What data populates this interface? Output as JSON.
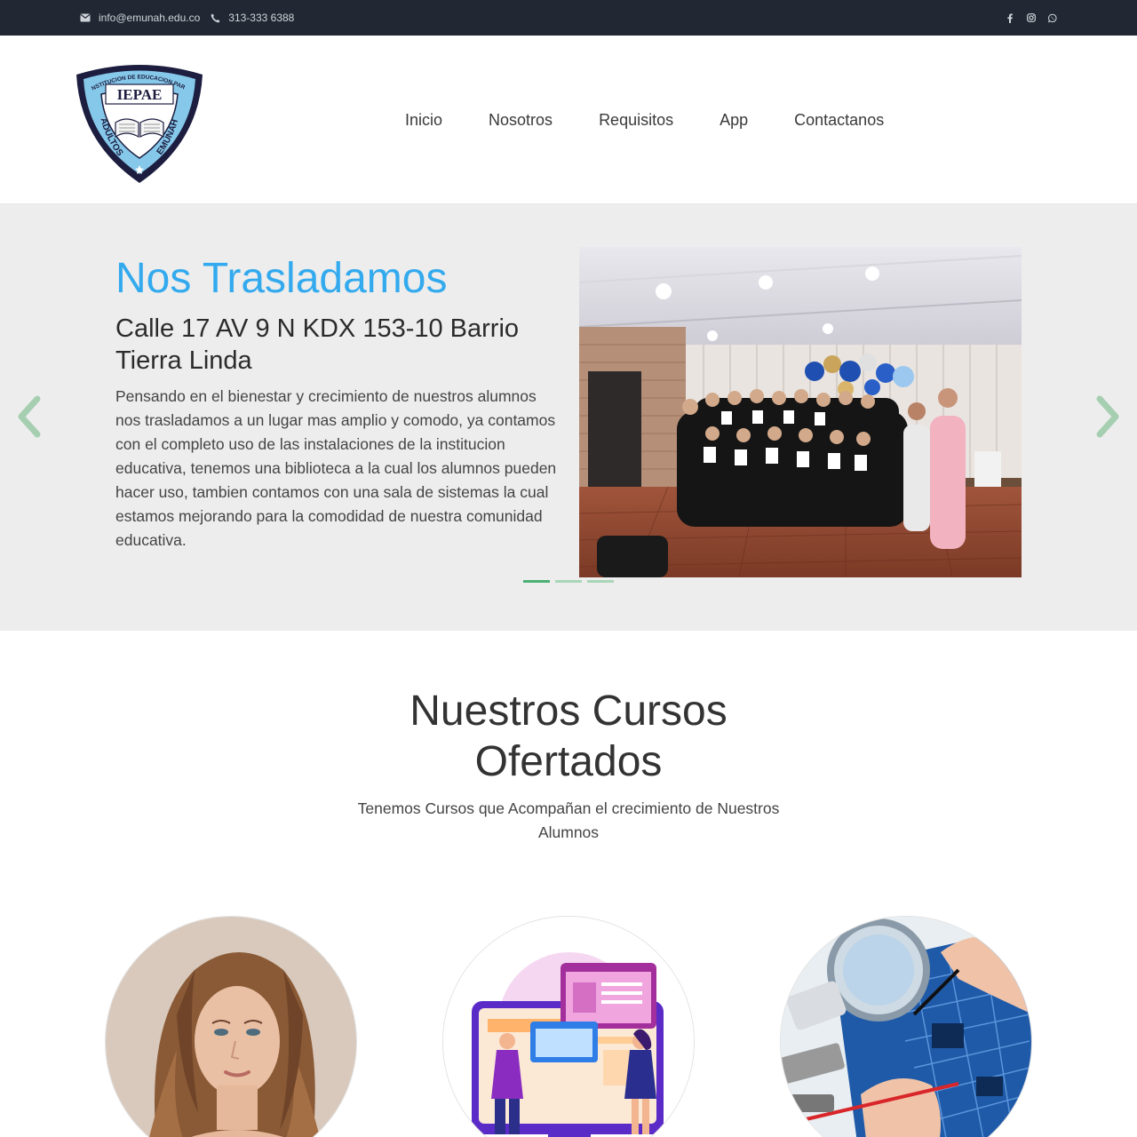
{
  "topbar": {
    "email": "info@emunah.edu.co",
    "phone": "313-333 6388",
    "email_icon": "envelope-icon",
    "phone_icon": "phone-icon",
    "social": [
      "facebook-icon",
      "instagram-icon",
      "whatsapp-icon"
    ]
  },
  "header": {
    "logo": {
      "name": "IEPAE",
      "arc_top": "INSTITUCION DE EDUCACION PARA",
      "left_text": "ADULTOS",
      "right_text": "EMUNAH"
    },
    "nav": [
      "Inicio",
      "Nosotros",
      "Requisitos",
      "App",
      "Contactanos"
    ]
  },
  "hero": {
    "title": "Nos Trasladamos",
    "subtitle": "Calle 17 AV 9 N KDX 153-10 Barrio Tierra Linda",
    "description": "Pensando en el bienestar y crecimiento de nuestros alumnos nos trasladamos a un lugar mas amplio y comodo, ya contamos con el completo uso de las instalaciones de la institucion educativa, tenemos una biblioteca a la cual los alumnos pueden hacer uso, tambien contamos con una sala de sistemas la cual estamos mejorando para la comodidad de nuestra comunidad educativa.",
    "slide_count": 3,
    "active_slide": 1,
    "prev_icon": "chevron-left-icon",
    "next_icon": "chevron-right-icon"
  },
  "courses": {
    "title": "Nuestros Cursos Ofertados",
    "subtitle": "Tenemos Cursos que Acompañan el crecimiento de Nuestros Alumnos"
  },
  "colors": {
    "topbar_bg": "#222833",
    "title_blue": "#33aaee",
    "hero_bg": "#ededed",
    "slider_green": "#4caf74"
  }
}
